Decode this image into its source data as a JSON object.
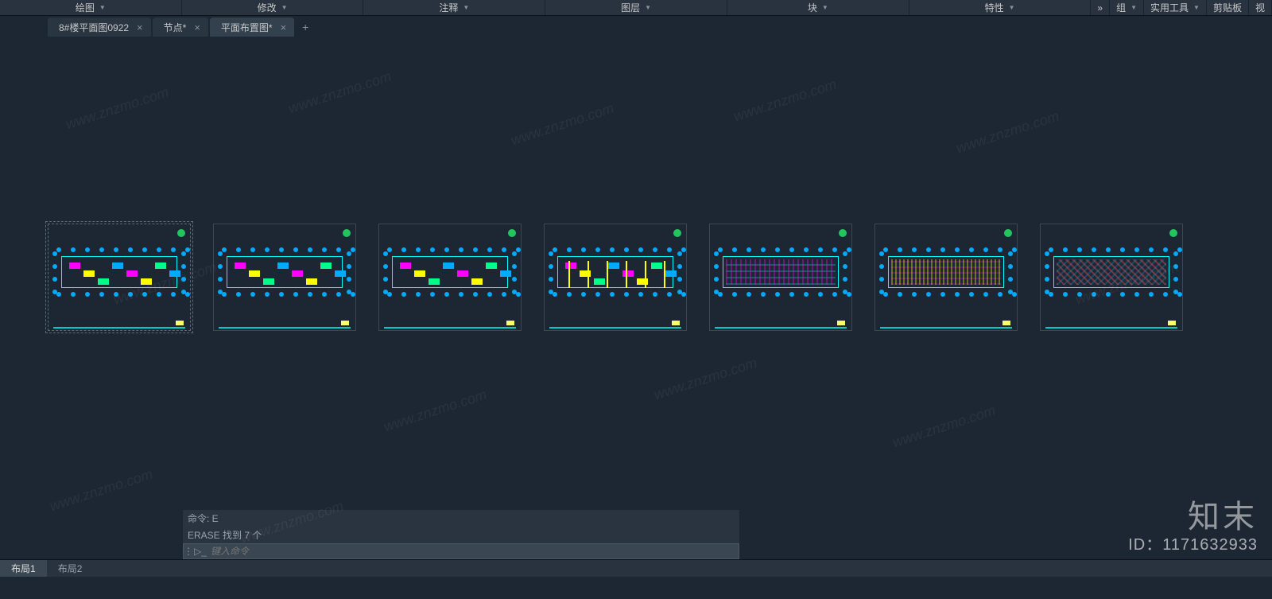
{
  "ribbon": [
    {
      "label": "绘图",
      "has_caret": true,
      "wide": true
    },
    {
      "label": "修改",
      "has_caret": true,
      "wide": true
    },
    {
      "label": "注释",
      "has_caret": true,
      "wide": true
    },
    {
      "label": "图层",
      "has_caret": true,
      "wide": true
    },
    {
      "label": "块",
      "has_caret": true,
      "wide": true
    },
    {
      "label": "特性",
      "has_caret": true,
      "wide": true
    },
    {
      "label": "»",
      "has_caret": false,
      "wide": false
    },
    {
      "label": "组",
      "has_caret": true,
      "wide": false
    },
    {
      "label": "实用工具",
      "has_caret": true,
      "wide": false
    },
    {
      "label": "剪贴板",
      "has_caret": false,
      "wide": false
    },
    {
      "label": "视",
      "has_caret": false,
      "wide": false
    }
  ],
  "doc_tabs": [
    {
      "label": "8#楼平面图0922",
      "active": false
    },
    {
      "label": "节点*",
      "active": false
    },
    {
      "label": "平面布置图*",
      "active": true
    }
  ],
  "tab_add_glyph": "+",
  "close_glyph": "×",
  "caret_glyph": "▼",
  "cmd": {
    "history": [
      "命令: E",
      "ERASE 找到 7 个"
    ],
    "placeholder": "键入命令",
    "prompt_icon": "▷_"
  },
  "layout_tabs": [
    {
      "label": "布局1",
      "active": true
    },
    {
      "label": "布局2",
      "active": false
    }
  ],
  "watermark": {
    "text": "www.znzmo.com",
    "logo": "知末",
    "id": "ID：1171632933"
  },
  "sheets": [
    {
      "selected": true,
      "variant": "simple"
    },
    {
      "selected": false,
      "variant": "simple"
    },
    {
      "selected": false,
      "variant": "simple"
    },
    {
      "selected": false,
      "variant": "mid"
    },
    {
      "selected": false,
      "variant": "dense"
    },
    {
      "selected": false,
      "variant": "dense2"
    },
    {
      "selected": false,
      "variant": "dense3"
    }
  ]
}
